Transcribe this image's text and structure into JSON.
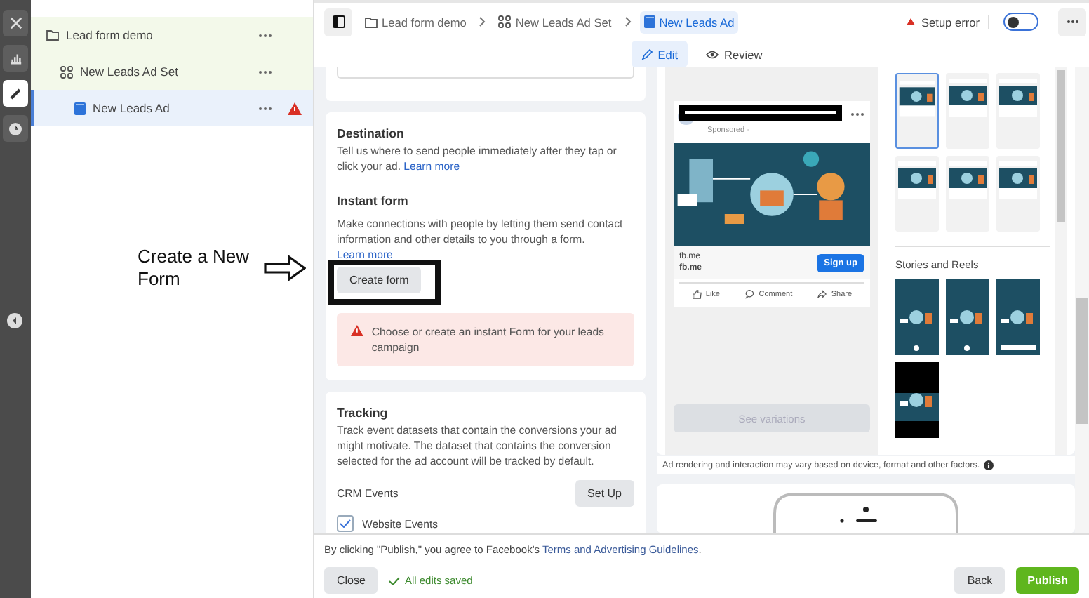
{
  "rail": [
    {
      "kind": "close",
      "selected": false
    },
    {
      "kind": "chart",
      "selected": false
    },
    {
      "kind": "edit",
      "selected": true
    },
    {
      "kind": "clock",
      "selected": false
    }
  ],
  "tree": [
    {
      "kind": "campaign",
      "label": "Lead form demo",
      "selected": false,
      "error": false,
      "children": [
        {
          "kind": "adset",
          "label": "New Leads Ad Set",
          "selected": false,
          "error": false,
          "children": [
            {
              "kind": "ad",
              "label": "New Leads Ad",
              "selected": true,
              "error": true
            }
          ]
        }
      ]
    }
  ],
  "breadcrumbs": [
    {
      "kind": "campaign",
      "label": "Lead form demo",
      "selected": false
    },
    {
      "kind": "adset",
      "label": "New Leads Ad Set",
      "selected": false
    },
    {
      "kind": "ad",
      "label": "New Leads Ad",
      "selected": true
    }
  ],
  "setup_status": {
    "label": "Setup error"
  },
  "toggle": {
    "on": false
  },
  "tabs": [
    {
      "kind": "edit",
      "label": "Edit",
      "selected": true
    },
    {
      "kind": "review",
      "label": "Review",
      "selected": false
    }
  ],
  "destination": {
    "title": "Destination",
    "text": "Tell us where to send people immediately after they tap or click your ad.",
    "link": "Learn more"
  },
  "instant_form": {
    "title": "Instant form",
    "text": "Make connections with people by letting them send contact information and other details to you through a form.",
    "link": "Learn more",
    "button": "Create form",
    "error": "Choose or create an instant Form for your leads campaign"
  },
  "annotation": {
    "text": "Create a New Form"
  },
  "tracking": {
    "title": "Tracking",
    "text": "Track event datasets that contain the conversions your ad might motivate. The dataset that contains the conversion selected for the ad account will be tracked by default.",
    "crm_label": "CRM Events",
    "setup_button": "Set Up",
    "website_events": {
      "label": "Website Events",
      "checked": true
    }
  },
  "preview": {
    "sponsored": "Sponsored ·",
    "domain": "fb.me",
    "headline": "fb.me",
    "cta": "Sign up",
    "actions": [
      {
        "kind": "like",
        "label": "Like"
      },
      {
        "kind": "comment",
        "label": "Comment"
      },
      {
        "kind": "share",
        "label": "Share"
      }
    ],
    "variations_button": "See variations",
    "feed_thumbnails": [
      {
        "selected": true
      },
      {
        "selected": false
      },
      {
        "selected": false
      },
      {
        "selected": false
      },
      {
        "selected": false
      },
      {
        "selected": false
      }
    ],
    "stories_title": "Stories and Reels",
    "story_thumbnails": [
      {
        "kind": "story"
      },
      {
        "kind": "story"
      },
      {
        "kind": "reel"
      },
      {
        "kind": "dark"
      }
    ],
    "note": "Ad rendering and interaction may vary based on device, format and other factors."
  },
  "footer": {
    "terms": "By clicking \"Publish,\" you agree to Facebook's",
    "terms_link": "Terms and Advertising Guidelines",
    "terms_end": ".",
    "close": "Close",
    "saved": "All edits saved",
    "back": "Back",
    "publish": "Publish"
  }
}
